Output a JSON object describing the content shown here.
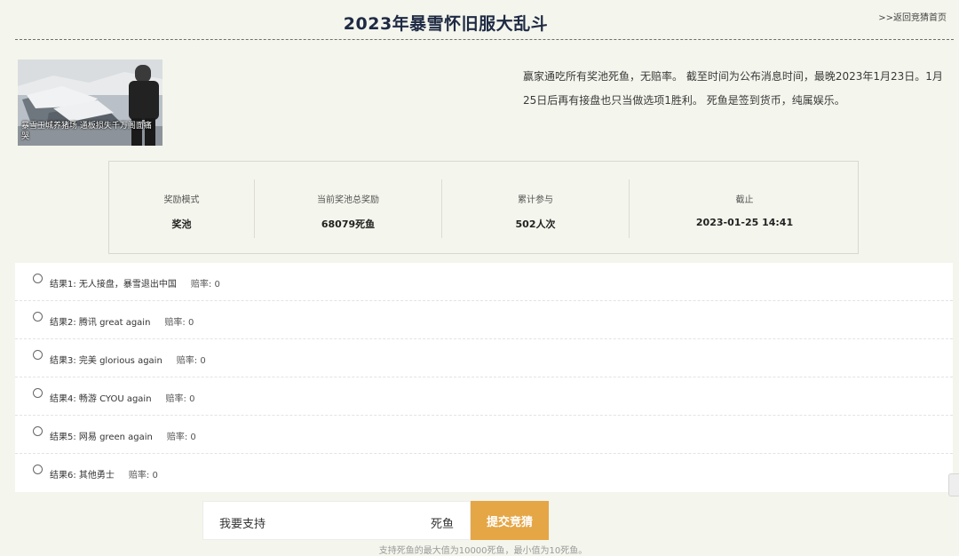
{
  "header": {
    "title": "2023年暴雪怀旧服大乱斗",
    "back_link": ">>返回竞猜首页"
  },
  "thumbnail": {
    "caption": "暴雪玉城养猪场 通板损失千万阁面痛哭"
  },
  "description": "赢家通吃所有奖池死鱼，无赔率。 截至时间为公布消息时间，最晚2023年1月23日。1月25日后再有接盘也只当做选项1胜利。 死鱼是签到货币，纯属娱乐。",
  "stats": [
    {
      "label": "奖励模式",
      "value": "奖池"
    },
    {
      "label": "当前奖池总奖励",
      "value": "68079死鱼"
    },
    {
      "label": "累计参与",
      "value": "502人次"
    },
    {
      "label": "截止",
      "value": "2023-01-25 14:41"
    }
  ],
  "options": [
    {
      "text": "结果1: 无人接盘，暴雪退出中国",
      "odds": "赔率: 0"
    },
    {
      "text": "结果2: 腾讯 great again",
      "odds": "赔率: 0"
    },
    {
      "text": "结果3: 完美 glorious again",
      "odds": "赔率: 0"
    },
    {
      "text": "结果4: 畅游 CYOU again",
      "odds": "赔率: 0"
    },
    {
      "text": "结果5: 网易 green again",
      "odds": "赔率: 0"
    },
    {
      "text": "结果6: 其他勇士",
      "odds": "赔率: 0"
    }
  ],
  "bet": {
    "label": "我要支持",
    "value": "",
    "unit": "死鱼",
    "submit_label": "提交竞猜",
    "hint": "支持死鱼的最大值为10000死鱼，最小值为10死鱼。"
  },
  "colors": {
    "background": "#f4f5ec",
    "title": "#1e2a44",
    "accent": "#e5a646"
  }
}
